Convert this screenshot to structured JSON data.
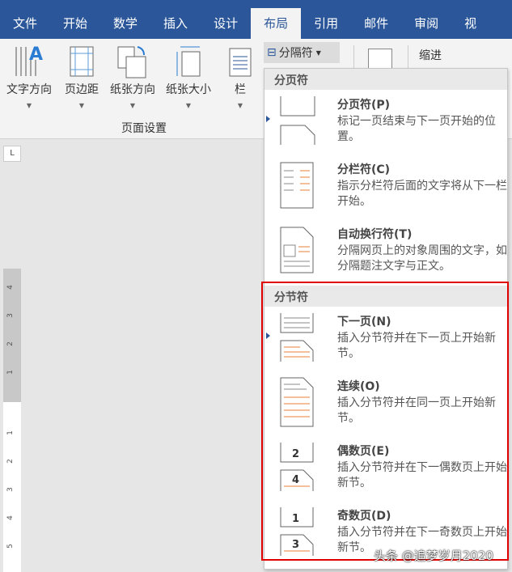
{
  "tabs": [
    "文件",
    "开始",
    "数学",
    "插入",
    "设计",
    "布局",
    "引用",
    "邮件",
    "审阅",
    "视"
  ],
  "active_tab": "布局",
  "ribbon": {
    "buttons": [
      "文字方向",
      "页边距",
      "纸张方向",
      "纸张大小",
      "栏"
    ],
    "group_label": "页面设置",
    "breaks_button": "分隔符",
    "indent_label": "缩进"
  },
  "ruler": {
    "corner": "L",
    "upper": [
      "4",
      "3",
      "2",
      "1"
    ],
    "lower": [
      "1",
      "2",
      "3",
      "4",
      "5"
    ]
  },
  "menu": {
    "page_breaks_header": "分页符",
    "page_breaks": [
      {
        "title": "分页符(P)",
        "desc": "标记一页结束与下一页开始的位置。"
      },
      {
        "title": "分栏符(C)",
        "desc": "指示分栏符后面的文字将从下一栏开始。"
      },
      {
        "title": "自动换行符(T)",
        "desc": "分隔网页上的对象周围的文字，如分隔题注文字与正文。"
      }
    ],
    "section_breaks_header": "分节符",
    "section_breaks": [
      {
        "title": "下一页(N)",
        "desc": "插入分节符并在下一页上开始新节。"
      },
      {
        "title": "连续(O)",
        "desc": "插入分节符并在同一页上开始新节。"
      },
      {
        "title": "偶数页(E)",
        "desc": "插入分节符并在下一偶数页上开始新节。"
      },
      {
        "title": "奇数页(D)",
        "desc": "插入分节符并在下一奇数页上开始新节。"
      }
    ]
  },
  "watermark": "头条 @追梦岁月2020",
  "colors": {
    "accent": "#2b579a",
    "highlight": "#e00000",
    "orange": "#e8813a"
  }
}
